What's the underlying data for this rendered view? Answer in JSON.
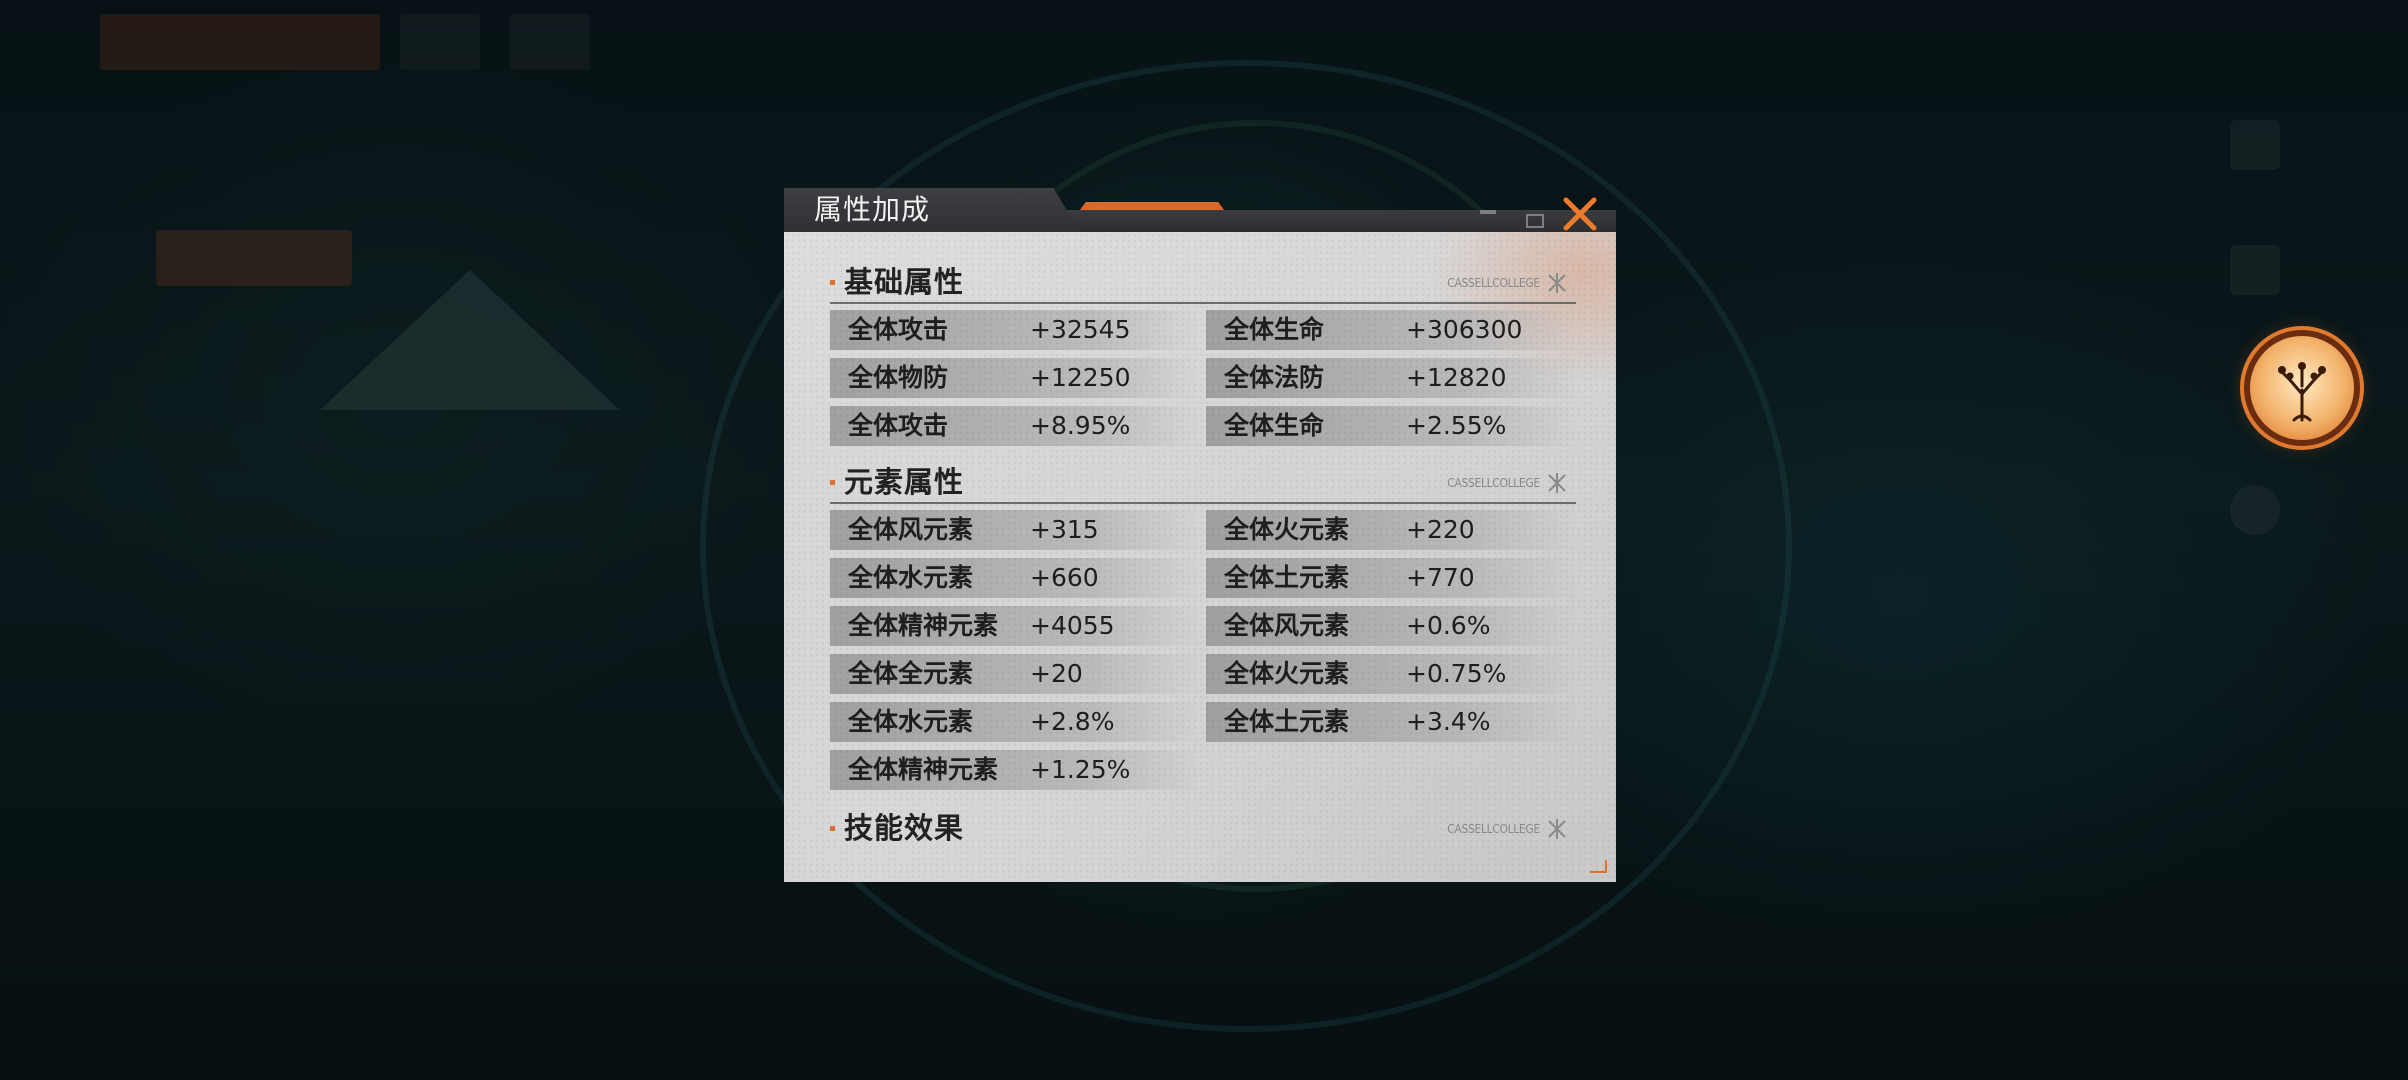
{
  "dialog": {
    "title": "属性加成",
    "close_icon": "close-x-icon"
  },
  "colors": {
    "accent": "#e0702e",
    "header": "#2e3033",
    "panel": "#d6d6d6"
  },
  "sections": [
    {
      "title": "基础属性",
      "watermark": "CASSELLCOLLEGE",
      "rows": [
        {
          "left_label": "全体攻击",
          "left_value": "+32545",
          "right_label": "全体生命",
          "right_value": "+306300"
        },
        {
          "left_label": "全体物防",
          "left_value": "+12250",
          "right_label": "全体法防",
          "right_value": "+12820"
        },
        {
          "left_label": "全体攻击",
          "left_value": "+8.95%",
          "right_label": "全体生命",
          "right_value": "+2.55%"
        }
      ]
    },
    {
      "title": "元素属性",
      "watermark": "CASSELLCOLLEGE",
      "rows": [
        {
          "left_label": "全体风元素",
          "left_value": "+315",
          "right_label": "全体火元素",
          "right_value": "+220"
        },
        {
          "left_label": "全体水元素",
          "left_value": "+660",
          "right_label": "全体土元素",
          "right_value": "+770"
        },
        {
          "left_label": "全体精神元素",
          "left_value": "+4055",
          "right_label": "全体风元素",
          "right_value": "+0.6%"
        },
        {
          "left_label": "全体全元素",
          "left_value": "+20",
          "right_label": "全体火元素",
          "right_value": "+0.75%"
        },
        {
          "left_label": "全体水元素",
          "left_value": "+2.8%",
          "right_label": "全体土元素",
          "right_value": "+3.4%"
        },
        {
          "left_label": "全体精神元素",
          "left_value": "+1.25%"
        }
      ]
    },
    {
      "title": "技能效果",
      "watermark": "CASSELLCOLLEGE",
      "rows": []
    }
  ],
  "side": {
    "avatar_icon": "tree-emblem-icon"
  }
}
